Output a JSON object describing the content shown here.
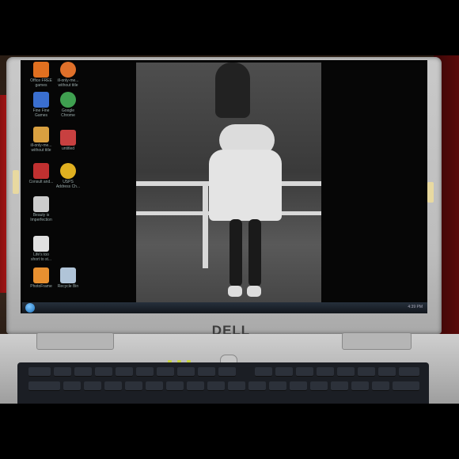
{
  "scene": {
    "description_tag": "photo-of-laptop-screen",
    "laptop_brand": "DELL"
  },
  "desktop": {
    "icons": [
      {
        "label": "Office FREE\ngames",
        "color": "#e07020"
      },
      {
        "label": "Fine Fine\nGames",
        "color": "#3a6fd0"
      },
      {
        "label": "ill-only-me...\nwithout title",
        "color": "#d9a040"
      },
      {
        "label": "Consult and...",
        "color": "#c03030"
      },
      {
        "label": "Beauty is\nImperfection",
        "color": "#cccccc"
      },
      {
        "label": "Life's too\nshort to st...",
        "color": "#e0e0e0"
      },
      {
        "label": "PhotoFrame",
        "color": "#e89030"
      },
      {
        "label": "ill-only-me...\nwithout title",
        "color": "#e0702a"
      },
      {
        "label": "Google\nChrome",
        "color": "#3fa050"
      },
      {
        "label": "untitled",
        "color": "#c84040"
      },
      {
        "label": "USPS\nAddress Ch...",
        "color": "#e0b020"
      },
      {
        "label": "Recycle Bin",
        "color": "#b0c4d8"
      }
    ],
    "taskbar": {
      "tray_text": "4:39 PM"
    }
  },
  "colors": {
    "lid_silver": "#c4c4c4",
    "screen_black": "#060606",
    "taskbar": "#1b2028",
    "led": "#c9d640"
  }
}
